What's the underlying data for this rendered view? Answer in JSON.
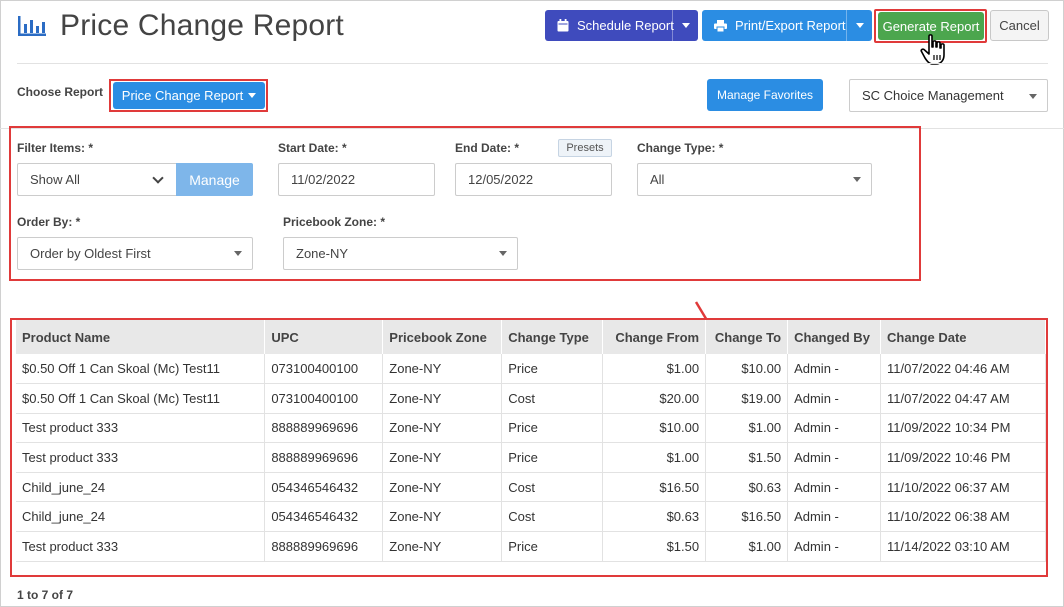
{
  "header": {
    "title": "Price Change Report",
    "schedule_label": "Schedule Report",
    "print_label": "Print/Export Report",
    "generate_label": "Generate Report",
    "cancel_label": "Cancel"
  },
  "report_row": {
    "choose_label": "Choose Report",
    "report_button_label": "Price Change Report",
    "favorites_label": "Manage Favorites",
    "org_select_value": "SC Choice Management"
  },
  "filters": {
    "filter_items_label": "Filter Items: *",
    "filter_items_value": "Show All",
    "manage_label": "Manage",
    "start_date_label": "Start Date: *",
    "start_date_value": "11/02/2022",
    "end_date_label": "End Date: *",
    "end_date_value": "12/05/2022",
    "presets_label": "Presets",
    "change_type_label": "Change Type: *",
    "change_type_value": "All",
    "order_by_label": "Order By: *",
    "order_by_value": "Order by Oldest First",
    "pricebook_zone_label": "Pricebook Zone: *",
    "pricebook_zone_value": "Zone-NY"
  },
  "table": {
    "columns": [
      "Product Name",
      "UPC",
      "Pricebook Zone",
      "Change Type",
      "Change From",
      "Change To",
      "Changed By",
      "Change Date"
    ],
    "rows": [
      [
        "$0.50 Off 1 Can Skoal (Mc) Test11",
        "073100400100",
        "Zone-NY",
        "Price",
        "$1.00",
        "$10.00",
        "Admin -",
        "11/07/2022 04:46 AM"
      ],
      [
        "$0.50 Off 1 Can Skoal (Mc) Test11",
        "073100400100",
        "Zone-NY",
        "Cost",
        "$20.00",
        "$19.00",
        "Admin -",
        "11/07/2022 04:47 AM"
      ],
      [
        "Test product 333",
        "888889969696",
        "Zone-NY",
        "Price",
        "$10.00",
        "$1.00",
        "Admin -",
        "11/09/2022 10:34 PM"
      ],
      [
        "Test product 333",
        "888889969696",
        "Zone-NY",
        "Price",
        "$1.00",
        "$1.50",
        "Admin -",
        "11/09/2022 10:46 PM"
      ],
      [
        "Child_june_24",
        "054346546432",
        "Zone-NY",
        "Cost",
        "$16.50",
        "$0.63",
        "Admin -",
        "11/10/2022 06:37 AM"
      ],
      [
        "Child_june_24",
        "054346546432",
        "Zone-NY",
        "Cost",
        "$0.63",
        "$16.50",
        "Admin -",
        "11/10/2022 06:38 AM"
      ],
      [
        "Test product 333",
        "888889969696",
        "Zone-NY",
        "Price",
        "$1.50",
        "$1.00",
        "Admin -",
        "11/14/2022 03:10 AM"
      ]
    ],
    "pager": "1 to 7 of 7"
  },
  "colors": {
    "highlight": "#e03a3a",
    "schedule": "#3f4bbd",
    "primary": "#2b8de3",
    "generate": "#4ca64e"
  },
  "icons": [
    "chart-bar-icon",
    "calendar-icon",
    "printer-icon",
    "hand-cursor-icon"
  ]
}
